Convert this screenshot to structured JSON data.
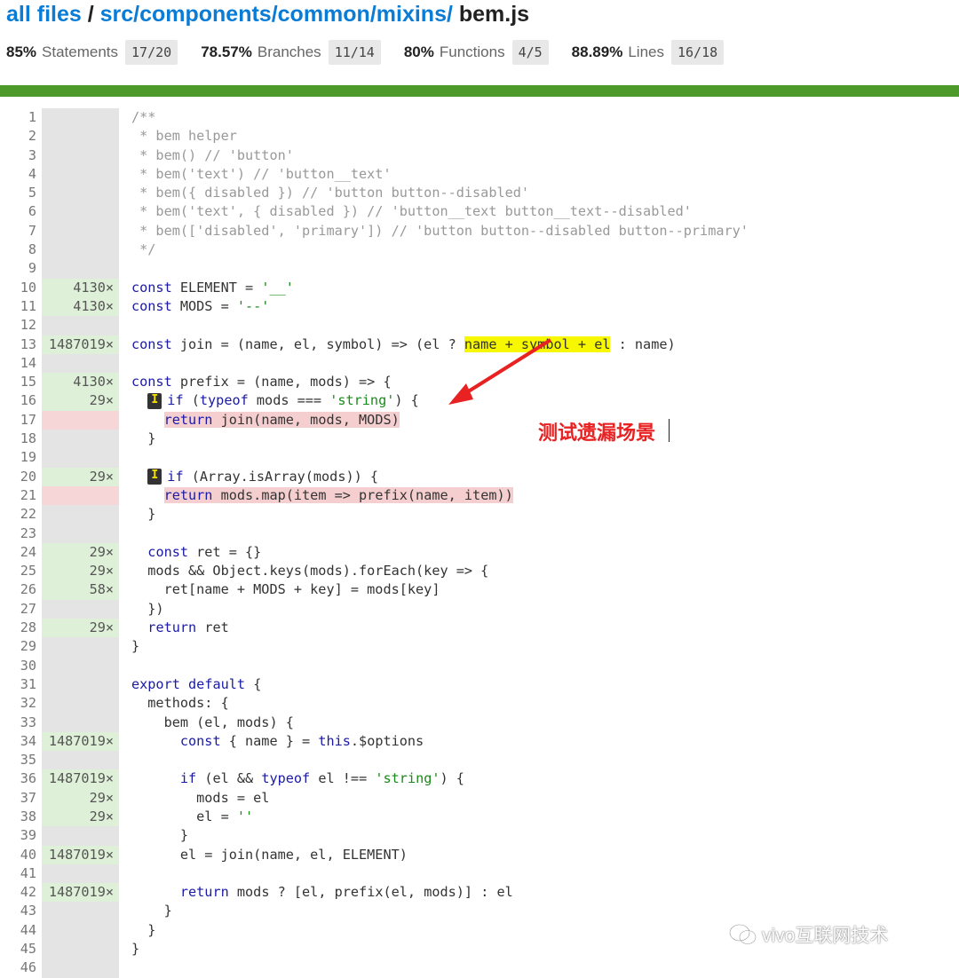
{
  "breadcrumb": {
    "all_files": "all files",
    "sep1": " / ",
    "dir": "src/components/common/mixins/",
    "file": " bem.js"
  },
  "stats": [
    {
      "pct": "85%",
      "label": "Statements",
      "frac": "17/20"
    },
    {
      "pct": "78.57%",
      "label": "Branches",
      "frac": "11/14"
    },
    {
      "pct": "80%",
      "label": "Functions",
      "frac": "4/5"
    },
    {
      "pct": "88.89%",
      "label": "Lines",
      "frac": "16/18"
    }
  ],
  "colors": {
    "covered": "#dff0d8",
    "uncovered": "#f6d6d6",
    "bar": "#4d9a2a",
    "link": "#0a7cd6",
    "annotation": "#e82222"
  },
  "lines": [
    {
      "n": "1",
      "c": "",
      "s": "/**"
    },
    {
      "n": "2",
      "c": "",
      "s": " * bem helper"
    },
    {
      "n": "3",
      "c": "",
      "s": " * bem() // 'button'"
    },
    {
      "n": "4",
      "c": "",
      "s": " * bem('text') // 'button__text'"
    },
    {
      "n": "5",
      "c": "",
      "s": " * bem({ disabled }) // 'button button--disabled'"
    },
    {
      "n": "6",
      "c": "",
      "s": " * bem('text', { disabled }) // 'button__text button__text--disabled'"
    },
    {
      "n": "7",
      "c": "",
      "s": " * bem(['disabled', 'primary']) // 'button button--disabled button--primary'"
    },
    {
      "n": "8",
      "c": "",
      "s": " */"
    },
    {
      "n": "9",
      "c": "",
      "s": ""
    },
    {
      "n": "10",
      "c": "4130×",
      "s": "const ELEMENT = '__'"
    },
    {
      "n": "11",
      "c": "4130×",
      "s": "const MODS = '--'"
    },
    {
      "n": "12",
      "c": "",
      "s": ""
    },
    {
      "n": "13",
      "c": "1487019×",
      "s": "const join = (name, el, symbol) => (el ? name + symbol + el : name)"
    },
    {
      "n": "14",
      "c": "",
      "s": ""
    },
    {
      "n": "15",
      "c": "4130×",
      "s": "const prefix = (name, mods) => {"
    },
    {
      "n": "16",
      "c": "29×",
      "s": "  if (typeof mods === 'string') {"
    },
    {
      "n": "17",
      "c": "",
      "s": "    return join(name, mods, MODS)"
    },
    {
      "n": "18",
      "c": "",
      "s": "  }"
    },
    {
      "n": "19",
      "c": "",
      "s": ""
    },
    {
      "n": "20",
      "c": "29×",
      "s": "  if (Array.isArray(mods)) {"
    },
    {
      "n": "21",
      "c": "",
      "s": "    return mods.map(item => prefix(name, item))"
    },
    {
      "n": "22",
      "c": "",
      "s": "  }"
    },
    {
      "n": "23",
      "c": "",
      "s": ""
    },
    {
      "n": "24",
      "c": "29×",
      "s": "  const ret = {}"
    },
    {
      "n": "25",
      "c": "29×",
      "s": "  mods && Object.keys(mods).forEach(key => {"
    },
    {
      "n": "26",
      "c": "58×",
      "s": "    ret[name + MODS + key] = mods[key]"
    },
    {
      "n": "27",
      "c": "",
      "s": "  })"
    },
    {
      "n": "28",
      "c": "29×",
      "s": "  return ret"
    },
    {
      "n": "29",
      "c": "",
      "s": "}"
    },
    {
      "n": "30",
      "c": "",
      "s": ""
    },
    {
      "n": "31",
      "c": "",
      "s": "export default {"
    },
    {
      "n": "32",
      "c": "",
      "s": "  methods: {"
    },
    {
      "n": "33",
      "c": "",
      "s": "    bem (el, mods) {"
    },
    {
      "n": "34",
      "c": "1487019×",
      "s": "      const { name } = this.$options"
    },
    {
      "n": "35",
      "c": "",
      "s": ""
    },
    {
      "n": "36",
      "c": "1487019×",
      "s": "      if (el && typeof el !== 'string') {"
    },
    {
      "n": "37",
      "c": "29×",
      "s": "        mods = el"
    },
    {
      "n": "38",
      "c": "29×",
      "s": "        el = ''"
    },
    {
      "n": "39",
      "c": "",
      "s": "      }"
    },
    {
      "n": "40",
      "c": "1487019×",
      "s": "      el = join(name, el, ELEMENT)"
    },
    {
      "n": "41",
      "c": "",
      "s": ""
    },
    {
      "n": "42",
      "c": "1487019×",
      "s": "      return mods ? [el, prefix(el, mods)] : el"
    },
    {
      "n": "43",
      "c": "",
      "s": "    }"
    },
    {
      "n": "44",
      "c": "",
      "s": "  }"
    },
    {
      "n": "45",
      "c": "",
      "s": "}"
    },
    {
      "n": "46",
      "c": "",
      "s": ""
    }
  ],
  "annotation": {
    "text": "测试遗漏场景"
  },
  "badge": {
    "label": "I"
  },
  "watermark": {
    "text": "vivo互联网技术",
    "icon": "wechat-icon"
  }
}
